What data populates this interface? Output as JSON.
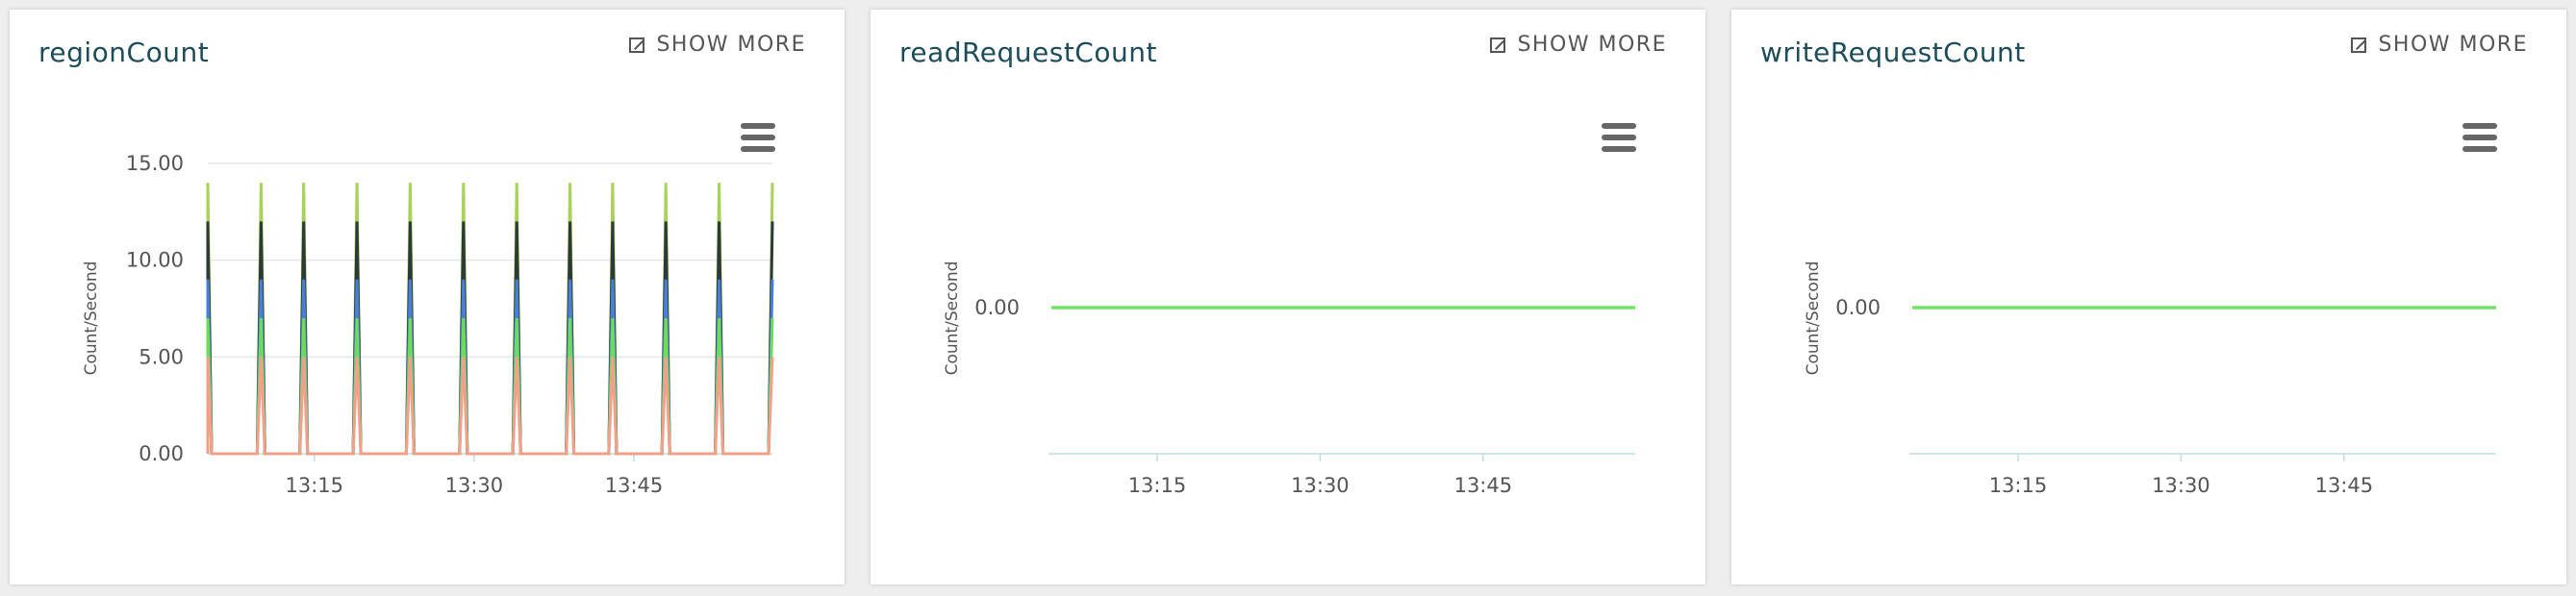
{
  "panels": [
    {
      "title": "regionCount",
      "show_more": "SHOW MORE"
    },
    {
      "title": "readRequestCount",
      "show_more": "SHOW MORE"
    },
    {
      "title": "writeRequestCount",
      "show_more": "SHOW MORE"
    }
  ],
  "icons": {
    "expand": "expand-icon",
    "menu": "hamburger-menu-icon"
  },
  "chart_data": [
    {
      "type": "line",
      "title": "regionCount",
      "ylabel": "Count/Second",
      "xlabel": "",
      "x_tick_labels": [
        "13:15",
        "13:30",
        "13:45"
      ],
      "y_tick_labels": [
        "0.00",
        "5.00",
        "10.00",
        "15.00"
      ],
      "ylim": [
        0,
        15
      ],
      "grid": true,
      "x_range_minutes": [
        "13:05",
        "13:58"
      ],
      "spike_minutes": [
        "13:05",
        "13:10",
        "13:14",
        "13:19",
        "13:24",
        "13:29",
        "13:34",
        "13:39",
        "13:43",
        "13:48",
        "13:53",
        "13:58"
      ],
      "series": [
        {
          "color": "#a8d25a",
          "peak": 14
        },
        {
          "color": "#2d3a3a",
          "peak": 12
        },
        {
          "color": "#4a7fd6",
          "peak": 9
        },
        {
          "color": "#6cdc5a",
          "peak": 7
        },
        {
          "color": "#f2a08a",
          "peak": 5
        }
      ]
    },
    {
      "type": "line",
      "title": "readRequestCount",
      "ylabel": "Count/Second",
      "xlabel": "",
      "x_tick_labels": [
        "13:15",
        "13:30",
        "13:45"
      ],
      "y_tick_labels": [
        "0.00"
      ],
      "x_range_minutes": [
        "13:05",
        "13:59"
      ],
      "series": [
        {
          "color": "#77e06a",
          "value": 0
        }
      ]
    },
    {
      "type": "line",
      "title": "writeRequestCount",
      "ylabel": "Count/Second",
      "xlabel": "",
      "x_tick_labels": [
        "13:15",
        "13:30",
        "13:45"
      ],
      "y_tick_labels": [
        "0.00"
      ],
      "x_range_minutes": [
        "13:05",
        "13:59"
      ],
      "series": [
        {
          "color": "#77e06a",
          "value": 0
        }
      ]
    }
  ]
}
